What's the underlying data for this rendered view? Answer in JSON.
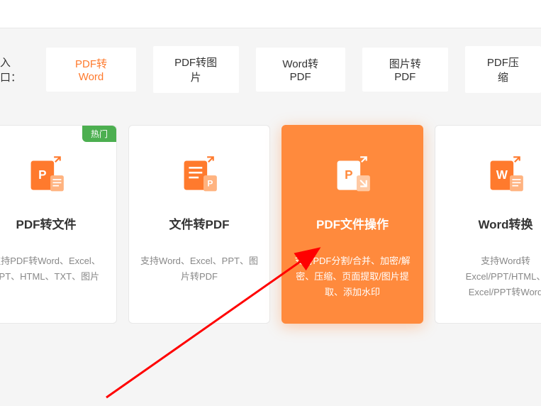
{
  "quickEntry": {
    "label": "入口：",
    "buttons": [
      {
        "label": "PDF转Word",
        "active": true
      },
      {
        "label": "PDF转图片",
        "active": false
      },
      {
        "label": "Word转PDF",
        "active": false
      },
      {
        "label": "图片转PDF",
        "active": false
      },
      {
        "label": "PDF压缩",
        "active": false
      }
    ]
  },
  "cards": [
    {
      "badge": "热门",
      "title": "PDF转文件",
      "desc": "支持PDF转Word、Excel、PPT、HTML、TXT、图片",
      "active": false,
      "iconLetter": "P",
      "iconColor": "#ff7a2d"
    },
    {
      "badge": "",
      "title": "文件转PDF",
      "desc": "支持Word、Excel、PPT、图片转PDF",
      "active": false,
      "iconLetter": "P",
      "iconColor": "#ff7a2d"
    },
    {
      "badge": "",
      "title": "PDF文件操作",
      "desc": "支持PDF分割/合并、加密/解密、压缩、页面提取/图片提取、添加水印",
      "active": true,
      "iconLetter": "P",
      "iconColor": "#fff"
    },
    {
      "badge": "",
      "title": "Word转换",
      "desc": "支持Word转Excel/PPT/HTML、Excel/PPT转Word",
      "active": false,
      "iconLetter": "W",
      "iconColor": "#ff7a2d"
    }
  ]
}
